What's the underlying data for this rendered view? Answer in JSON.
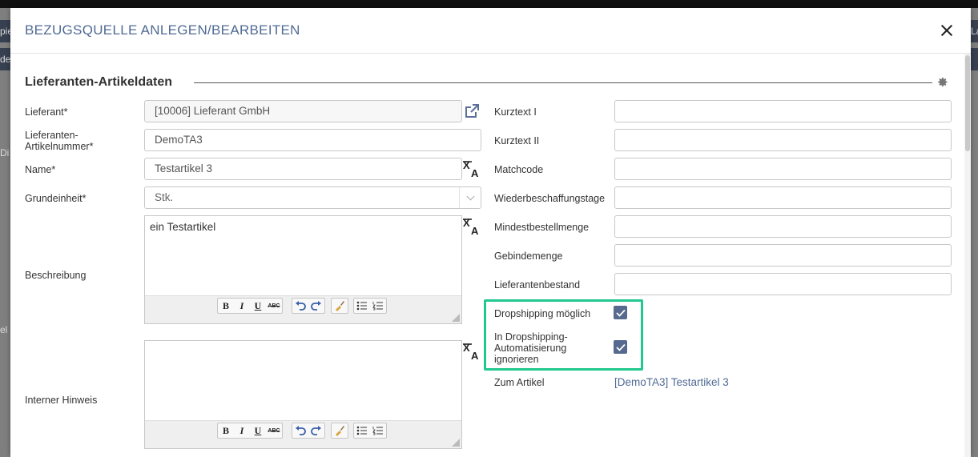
{
  "dialog": {
    "title": "BEZUGSQUELLE ANLEGEN/BEARBEITEN"
  },
  "section": {
    "title": "Lieferanten-Artikeldaten"
  },
  "background_fragments": [
    "pie",
    "de",
    "Di",
    "el s",
    "La"
  ],
  "left_fields": {
    "lieferant": {
      "label": "Lieferant*",
      "value": "[10006] Lieferant GmbH"
    },
    "artikelnummer": {
      "label_line1": "Lieferanten-",
      "label_line2": "Artikelnummer*",
      "value": "DemoTA3"
    },
    "name": {
      "label": "Name*",
      "value": "Testartikel 3"
    },
    "grundeinheit": {
      "label": "Grundeinheit*",
      "value": "Stk."
    },
    "beschreibung": {
      "label": "Beschreibung",
      "value": "ein Testartikel"
    },
    "interner_hinweis": {
      "label": "Interner Hinweis",
      "value": ""
    }
  },
  "editor_toolbar": {
    "bold": "B",
    "italic": "I",
    "underline": "U",
    "strike": "ABC"
  },
  "right_fields": {
    "kurztext1": {
      "label": "Kurztext I",
      "value": ""
    },
    "kurztext2": {
      "label": "Kurztext II",
      "value": ""
    },
    "matchcode": {
      "label": "Matchcode",
      "value": ""
    },
    "wiederbeschaffungstage": {
      "label": "Wiederbeschaffungstage",
      "value": ""
    },
    "mindestbestellmenge": {
      "label": "Mindestbestellmenge",
      "value": ""
    },
    "gebindemenge": {
      "label": "Gebindemenge",
      "value": ""
    },
    "lieferantenbestand": {
      "label": "Lieferantenbestand",
      "value": ""
    }
  },
  "dropshipping": {
    "possible_label": "Dropshipping möglich",
    "possible_checked": true,
    "ignore_label_line1": "In Dropshipping-",
    "ignore_label_line2": "Automatisierung",
    "ignore_label_line3": "ignorieren",
    "ignore_checked": true
  },
  "zum_artikel": {
    "label": "Zum Artikel",
    "link": "[DemoTA3] Testartikel 3"
  },
  "colors": {
    "title": "#4f6a94",
    "checkbox": "#56698f",
    "highlight": "#22c98f"
  }
}
